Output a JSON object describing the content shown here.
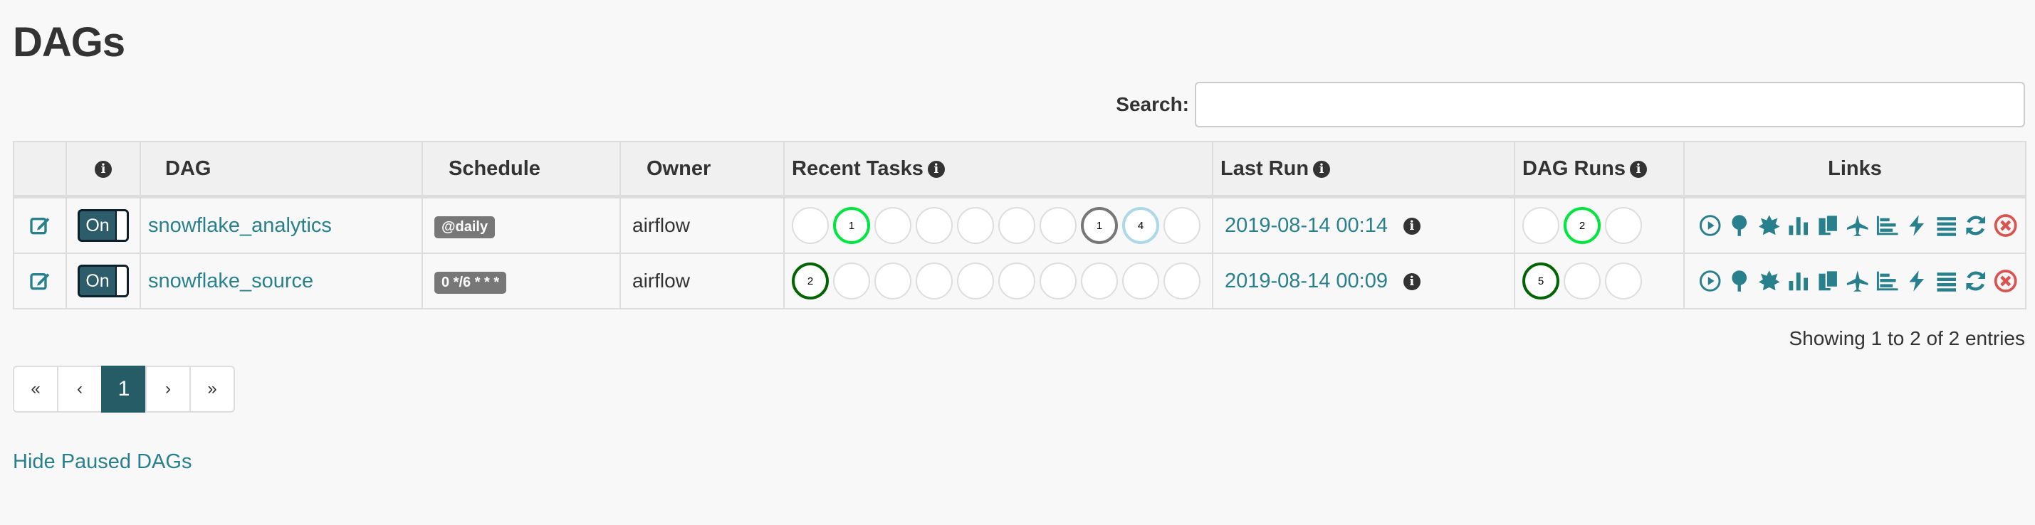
{
  "page": {
    "title": "DAGs"
  },
  "search": {
    "label": "Search:",
    "value": "",
    "placeholder": ""
  },
  "table": {
    "headers": {
      "info": "i",
      "dag": "DAG",
      "schedule": "Schedule",
      "owner": "Owner",
      "recent_tasks": "Recent Tasks",
      "last_run": "Last Run",
      "dag_runs": "DAG Runs",
      "links": "Links"
    },
    "rows": [
      {
        "toggle": "On",
        "dag": "snowflake_analytics",
        "schedule": "@daily",
        "owner": "airflow",
        "recent_tasks": [
          {
            "count": "",
            "state": "none"
          },
          {
            "count": "1",
            "state": "success"
          },
          {
            "count": "",
            "state": "none"
          },
          {
            "count": "",
            "state": "none"
          },
          {
            "count": "",
            "state": "none"
          },
          {
            "count": "",
            "state": "none"
          },
          {
            "count": "",
            "state": "none"
          },
          {
            "count": "1",
            "state": "skipped"
          },
          {
            "count": "4",
            "state": "scheduled"
          },
          {
            "count": "",
            "state": "none"
          }
        ],
        "last_run": "2019-08-14 00:14",
        "dag_runs": [
          {
            "count": "",
            "state": "none"
          },
          {
            "count": "2",
            "state": "success"
          },
          {
            "count": "",
            "state": "none"
          }
        ]
      },
      {
        "toggle": "On",
        "dag": "snowflake_source",
        "schedule": "0 */6 * * *",
        "owner": "airflow",
        "recent_tasks": [
          {
            "count": "2",
            "state": "darkgreen"
          },
          {
            "count": "",
            "state": "none"
          },
          {
            "count": "",
            "state": "none"
          },
          {
            "count": "",
            "state": "none"
          },
          {
            "count": "",
            "state": "none"
          },
          {
            "count": "",
            "state": "none"
          },
          {
            "count": "",
            "state": "none"
          },
          {
            "count": "",
            "state": "none"
          },
          {
            "count": "",
            "state": "none"
          },
          {
            "count": "",
            "state": "none"
          }
        ],
        "last_run": "2019-08-14 00:09",
        "dag_runs": [
          {
            "count": "5",
            "state": "darkgreen"
          },
          {
            "count": "",
            "state": "none"
          },
          {
            "count": "",
            "state": "none"
          }
        ]
      }
    ]
  },
  "links_icons": [
    "trigger-dag-icon",
    "tree-view-icon",
    "graph-view-icon",
    "duration-icon",
    "task-tries-icon",
    "landing-times-icon",
    "gantt-icon",
    "code-icon",
    "logs-icon",
    "refresh-icon",
    "delete-icon"
  ],
  "footer": {
    "showing": "Showing 1 to 2 of 2 entries",
    "hide_paused": "Hide Paused DAGs"
  },
  "pagination": {
    "first": "«",
    "prev": "‹",
    "current": "1",
    "next": "›",
    "last": "»"
  },
  "colors": {
    "link": "#29808d",
    "toggle_on": "#2d5c6a",
    "page_active": "#265c66",
    "success": "#00e53f",
    "darkgreen": "#006400",
    "skipped": "#777777",
    "scheduled": "#add8e6",
    "delete": "#d9534f"
  }
}
